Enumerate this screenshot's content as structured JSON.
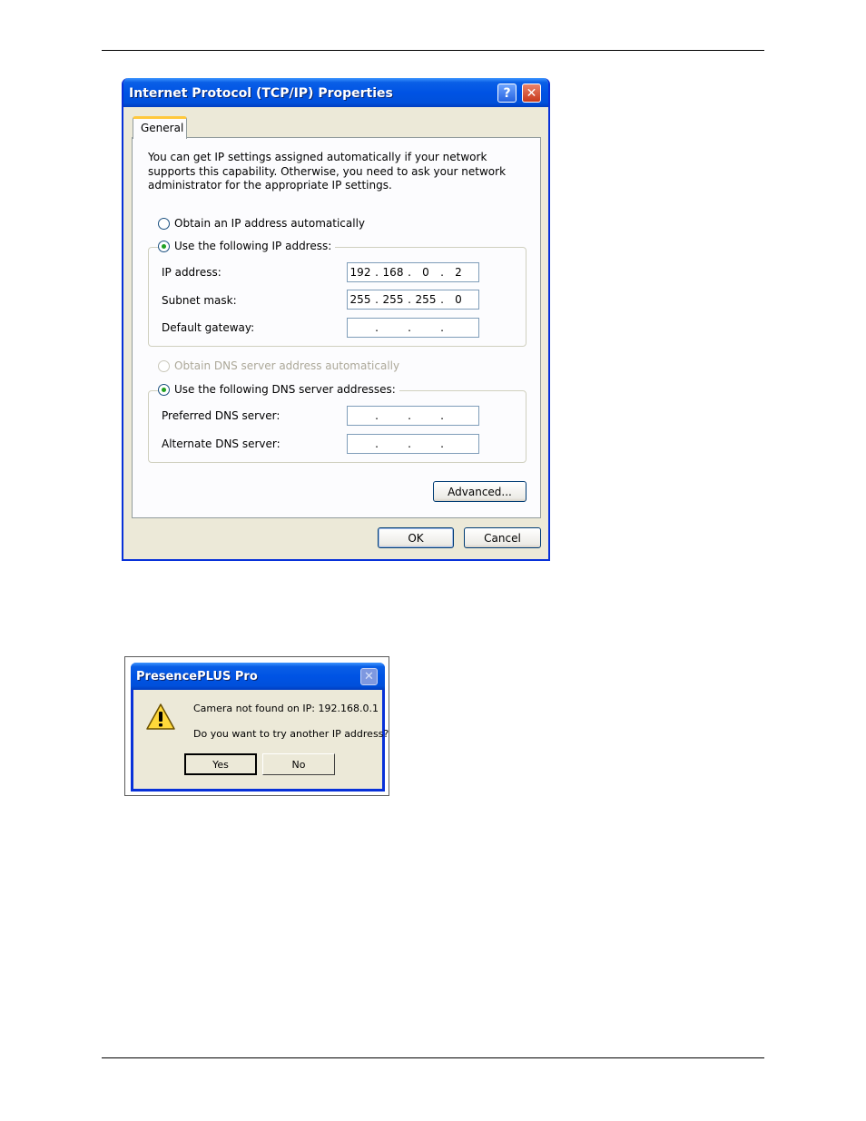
{
  "tcpip_dialog": {
    "title": "Internet Protocol (TCP/IP) Properties",
    "help_icon": "?",
    "close_icon": "✕",
    "tab_general": "General",
    "intro_text": "You can get IP settings assigned automatically if your network supports this capability. Otherwise, you need to ask your network administrator for the appropriate IP settings.",
    "radio_obtain_ip": "Obtain an IP address automatically",
    "radio_use_ip": "Use the following IP address:",
    "ip_label": "IP address:",
    "ip_value": [
      "192",
      "168",
      "0",
      "2"
    ],
    "subnet_label": "Subnet mask:",
    "subnet_value": [
      "255",
      "255",
      "255",
      "0"
    ],
    "gateway_label": "Default gateway:",
    "radio_obtain_dns": "Obtain DNS server address automatically",
    "radio_use_dns": "Use the following DNS server addresses:",
    "preferred_dns_label": "Preferred DNS server:",
    "alternate_dns_label": "Alternate DNS server:",
    "advanced_button": "Advanced...",
    "ok_button": "OK",
    "cancel_button": "Cancel"
  },
  "presence_dialog": {
    "title": "PresencePLUS Pro",
    "close_icon": "✕",
    "message_line1": "Camera not found on IP: 192.168.0.1",
    "message_line2": "Do you want to try another IP address?",
    "yes_button": "Yes",
    "no_button": "No"
  },
  "colors": {
    "title_blue": "#0053e4",
    "dialog_face": "#ece9d8",
    "radio_dot": "#21a121",
    "tab_highlight": "#ffc83c"
  }
}
